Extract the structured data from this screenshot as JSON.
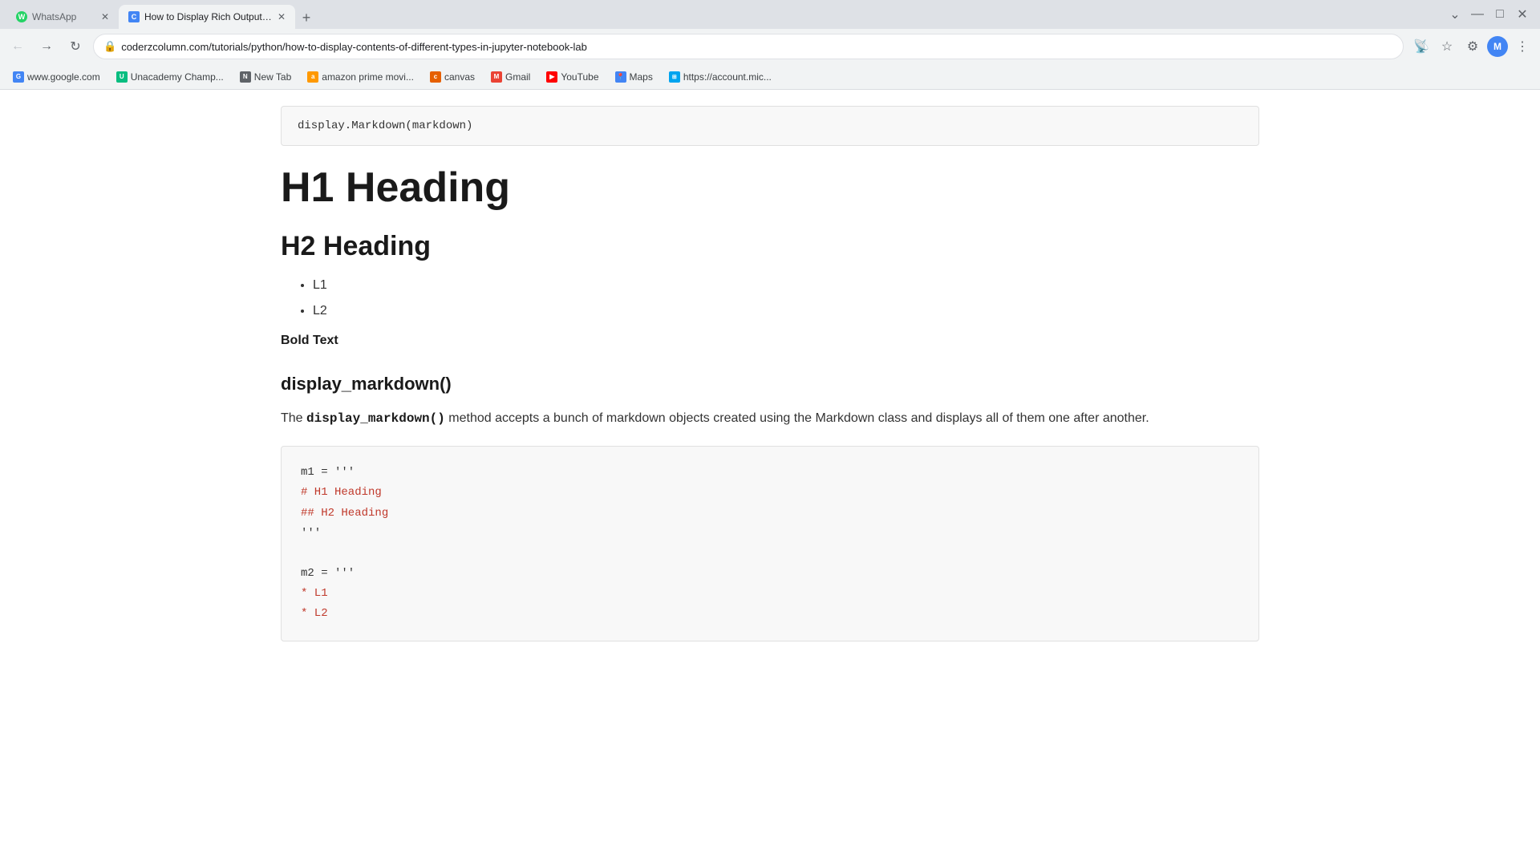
{
  "browser": {
    "tabs": [
      {
        "id": "tab-whatsapp",
        "title": "WhatsApp",
        "favicon_color": "#25D366",
        "favicon_char": "W",
        "active": false
      },
      {
        "id": "tab-article",
        "title": "How to Display Rich Outputs (in...",
        "favicon_color": "#4285f4",
        "favicon_char": "C",
        "active": true
      }
    ],
    "url": "coderzcolumn.com/tutorials/python/how-to-display-contents-of-different-types-in-jupyter-notebook-lab",
    "new_tab_label": "+",
    "window_controls": {
      "minimize": "—",
      "maximize": "□",
      "close": "✕"
    }
  },
  "bookmarks": [
    {
      "id": "google",
      "label": "www.google.com",
      "color": "#4285f4"
    },
    {
      "id": "unacademy",
      "label": "Unacademy Champ...",
      "color": "#08BD80"
    },
    {
      "id": "new-tab",
      "label": "New Tab",
      "color": "#5f6368"
    },
    {
      "id": "amazon",
      "label": "amazon prime movi...",
      "color": "#FF9900"
    },
    {
      "id": "canvas",
      "label": "canvas",
      "color": "#E66000"
    },
    {
      "id": "gmail",
      "label": "Gmail",
      "color": "#EA4335"
    },
    {
      "id": "youtube",
      "label": "YouTube",
      "color": "#FF0000"
    },
    {
      "id": "maps",
      "label": "Maps",
      "color": "#4285f4"
    },
    {
      "id": "microsoft",
      "label": "https://account.mic...",
      "color": "#00A4EF"
    }
  ],
  "page": {
    "code_top": "display.Markdown(markdown)",
    "h1": "H1 Heading",
    "h2": "H2 Heading",
    "list_items": [
      "L1",
      "L2"
    ],
    "bold_text": "Bold Text",
    "function_heading": "display_markdown()",
    "description_before": "The ",
    "description_inline_code": "display_markdown()",
    "description_after": " method accepts a bunch of markdown objects created using the Markdown class and displays all of them one after another.",
    "code_lines": [
      {
        "text": "m1 = '''",
        "type": "plain"
      },
      {
        "text": "# H1 Heading",
        "type": "string"
      },
      {
        "text": "## H2 Heading",
        "type": "string"
      },
      {
        "text": "'''",
        "type": "plain"
      },
      {
        "text": "",
        "type": "plain"
      },
      {
        "text": "m2 = '''",
        "type": "plain"
      },
      {
        "text": "* L1",
        "type": "string"
      },
      {
        "text": "* L2",
        "type": "string"
      }
    ],
    "profile_initial": "M"
  }
}
